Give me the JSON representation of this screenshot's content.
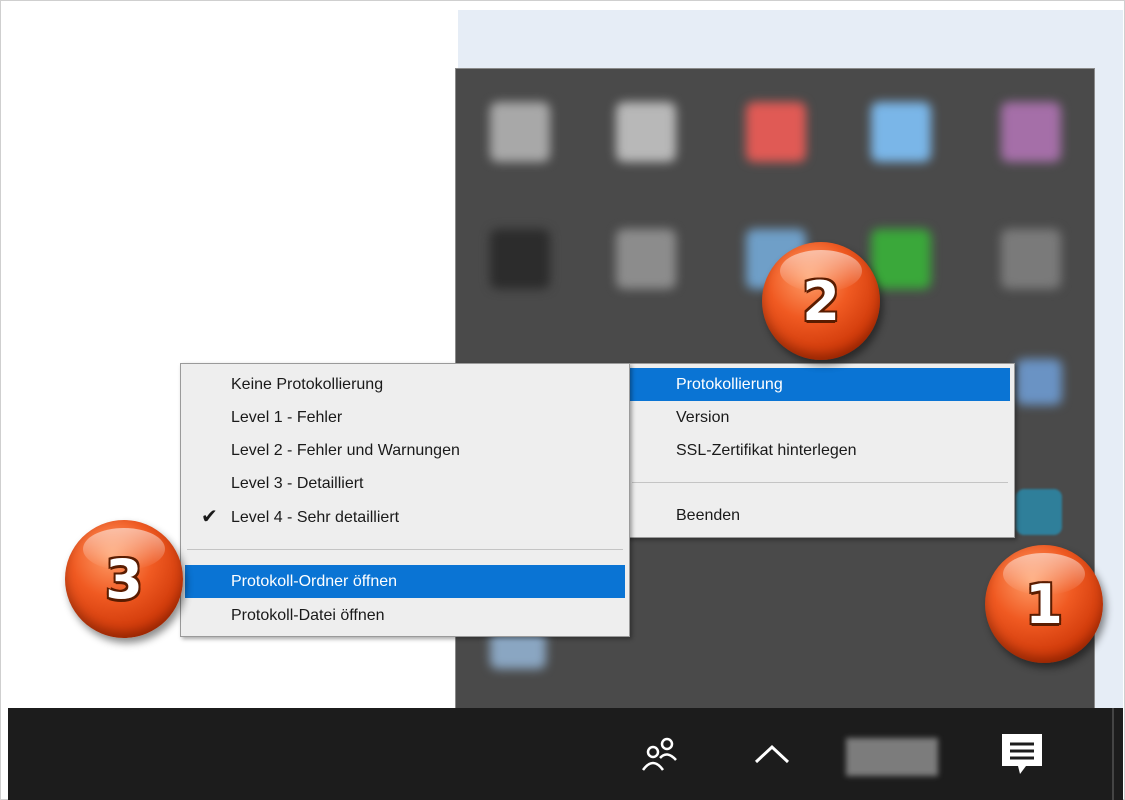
{
  "submenu_logging": {
    "items": [
      {
        "label": "Keine Protokollierung",
        "checked": false
      },
      {
        "label": "Level 1 - Fehler",
        "checked": false
      },
      {
        "label": "Level 2 - Fehler und Warnungen",
        "checked": false
      },
      {
        "label": "Level 3 - Detailliert",
        "checked": false
      },
      {
        "label": "Level 4 - Sehr detailliert",
        "checked": true
      }
    ],
    "actions": [
      {
        "label": "Protokoll-Ordner öffnen",
        "selected": true
      },
      {
        "label": "Protokoll-Datei öffnen",
        "selected": false
      }
    ],
    "check_glyph": "✔"
  },
  "context_menu": {
    "items": [
      {
        "label": "Protokollierung",
        "selected": true
      },
      {
        "label": "Version",
        "selected": false
      },
      {
        "label": "SSL-Zertifikat hinterlegen",
        "selected": false
      }
    ],
    "exit_label": "Beenden"
  },
  "badges": {
    "one": "1",
    "two": "2",
    "three": "3"
  },
  "tray_icons": [
    {
      "name": "tray-app-icon",
      "color": "#a8a8a8"
    },
    {
      "name": "tray-app-icon",
      "color": "#b8b8b8"
    },
    {
      "name": "tray-app-icon",
      "color": "#e05a55"
    },
    {
      "name": "tray-app-icon",
      "color": "#7ab6e8"
    },
    {
      "name": "tray-app-icon",
      "color": "#a56fa8"
    },
    {
      "name": "tray-app-icon",
      "color": "#2c2c2c"
    },
    {
      "name": "tray-app-icon",
      "color": "#8c8c8c"
    },
    {
      "name": "tray-app-icon",
      "color": "#6f9fc8"
    },
    {
      "name": "tray-app-icon",
      "color": "#3aa83a"
    },
    {
      "name": "tray-app-icon",
      "color": "#7a7a7a"
    }
  ],
  "taskbar": {
    "icons": [
      "people-icon",
      "chevron-up-icon",
      "clock-icon",
      "action-center-icon"
    ]
  },
  "colors": {
    "selection": "#0a74d4",
    "menu_bg": "#eeeeee",
    "panel_bg": "#4a4a4a",
    "taskbar_bg": "#1c1c1c",
    "badge": "#e8501a"
  }
}
